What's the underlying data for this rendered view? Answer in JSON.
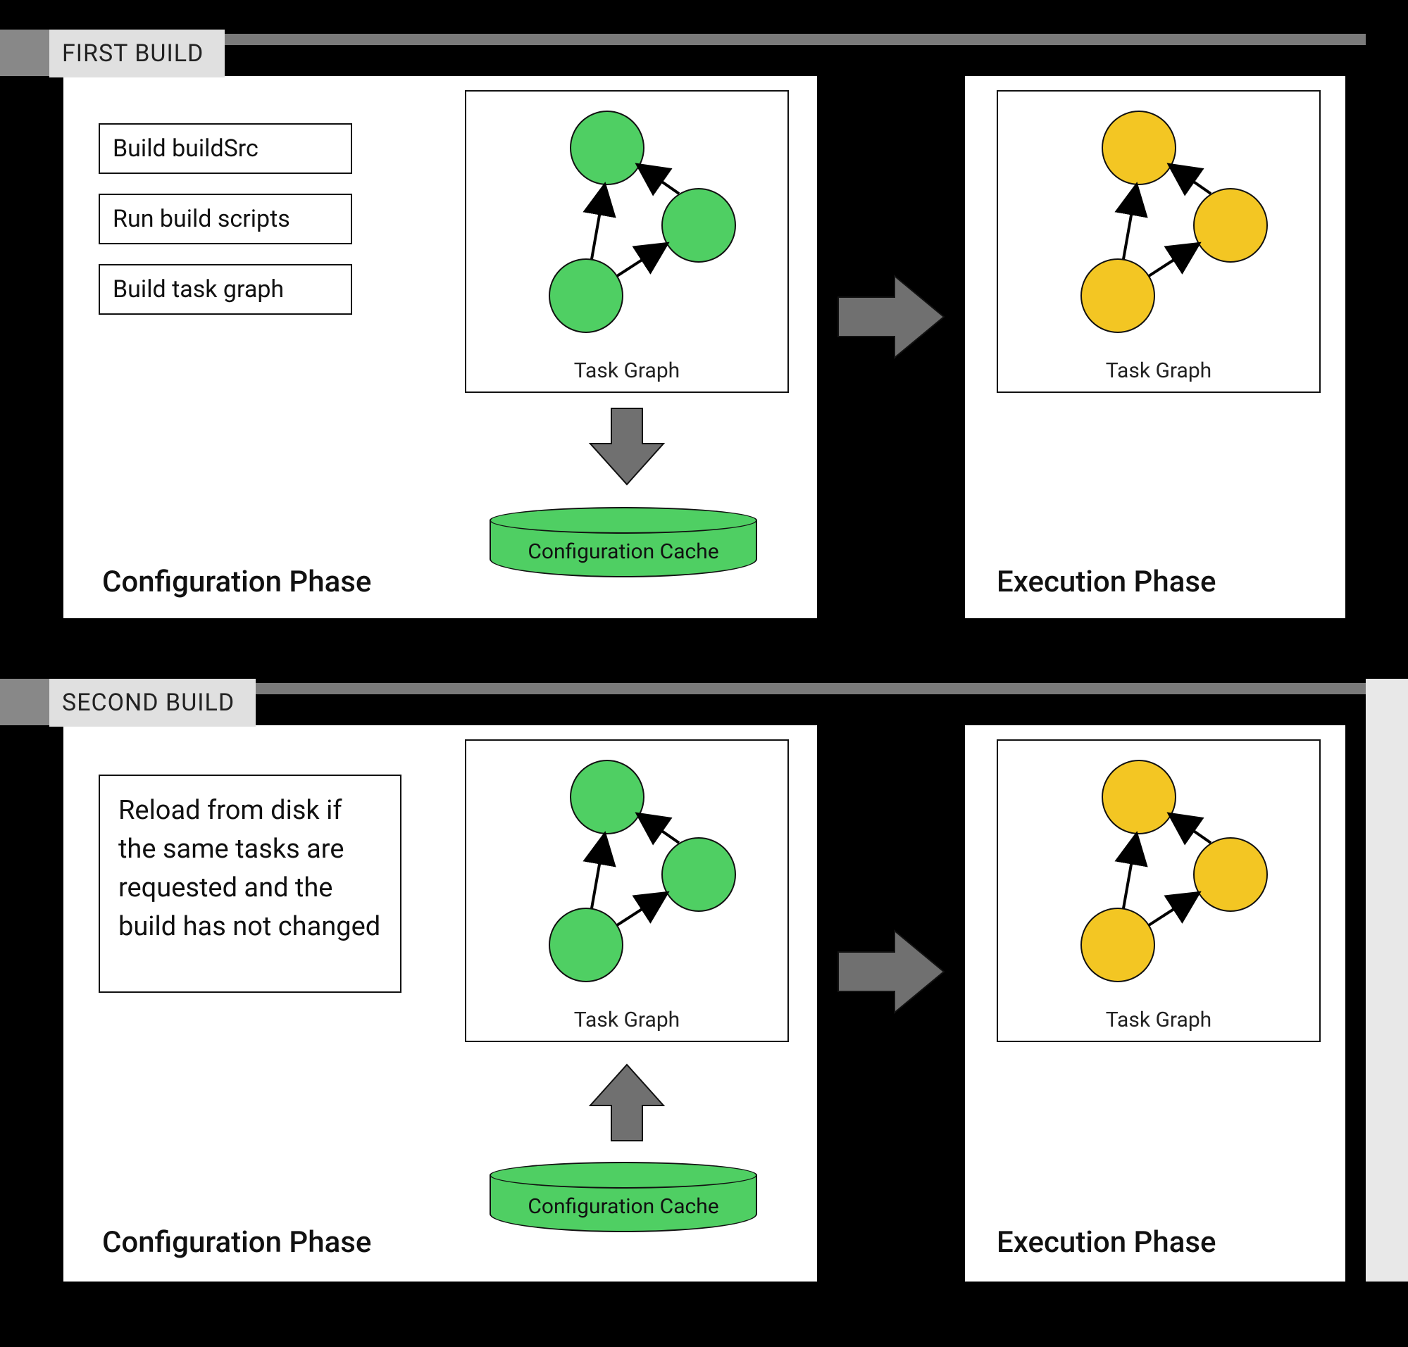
{
  "colors": {
    "green": "#4fcf63",
    "yellow": "#f3c623",
    "arrowGray": "#707070"
  },
  "build1": {
    "label": "FIRST BUILD",
    "steps": [
      "Build buildSrc",
      "Run build scripts",
      "Build task graph"
    ],
    "configPhaseTitle": "Configuration Phase",
    "execPhaseTitle": "Execution Phase",
    "taskGraphCaption": "Task Graph",
    "cacheLabel": "Configuration Cache",
    "cacheArrowDirection": "down"
  },
  "build2": {
    "label": "SECOND BUILD",
    "note": "Reload from disk if the same tasks are requested and the build has not changed",
    "configPhaseTitle": "Configuration Phase",
    "execPhaseTitle": "Execution Phase",
    "taskGraphCaption": "Task Graph",
    "cacheLabel": "Configuration Cache",
    "cacheArrowDirection": "up"
  }
}
